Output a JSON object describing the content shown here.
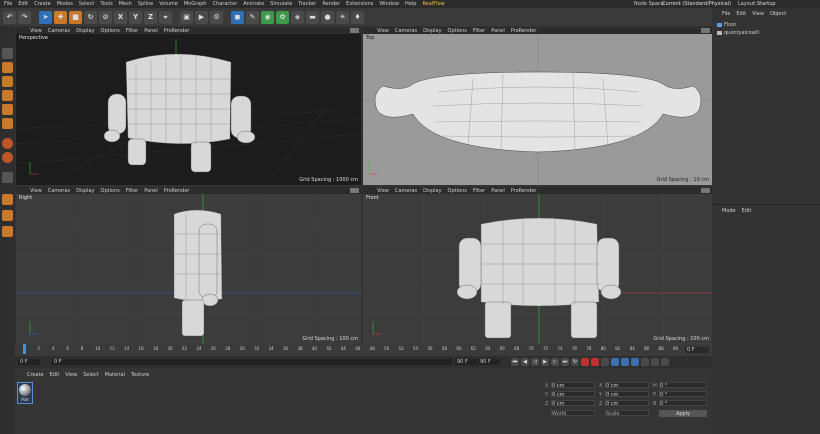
{
  "menu": {
    "items": [
      "File",
      "Edit",
      "Create",
      "Modes",
      "Select",
      "Tools",
      "Mesh",
      "Spline",
      "Volume",
      "MoGraph",
      "Character",
      "Animate",
      "Simulate",
      "Tracker",
      "Render",
      "Extensions",
      "Window",
      "Help",
      "RealFlow"
    ],
    "node_space_label": "Node Space:",
    "node_space_value": "Current (Standard/Physical)",
    "layout_label": "Layout:",
    "layout_value": "Startup"
  },
  "toolbar": {
    "icons": [
      "undo-icon",
      "redo-icon",
      "select-icon",
      "move-icon",
      "scale-icon",
      "rotate-icon",
      "recent-icon",
      "x-axis-icon",
      "y-axis-icon",
      "z-axis-icon",
      "coordinate-system-icon",
      "render-view-icon",
      "render-picture-icon",
      "render-settings-icon",
      "cube-icon",
      "pen-icon",
      "subdivision-icon",
      "cloner-icon",
      "deformer-icon",
      "floor-icon",
      "camera-icon",
      "light-icon",
      "lamp-icon"
    ],
    "axis_labels": [
      "X",
      "Y",
      "Z"
    ]
  },
  "viewport_menu": [
    "View",
    "Cameras",
    "Display",
    "Options",
    "Filter",
    "Panel",
    "ProRender"
  ],
  "viewports": [
    {
      "label": "Perspective",
      "grid": "Grid Spacing : 1000 cm"
    },
    {
      "label": "Top",
      "grid": "Grid Spacing : 10 cm"
    },
    {
      "label": "Right",
      "grid": "Grid Spacing : 100 cm"
    },
    {
      "label": "Front",
      "grid": "Grid Spacing : 100 cm"
    }
  ],
  "object_manager": {
    "menu": [
      "File",
      "Edit",
      "View",
      "Object"
    ],
    "objects": [
      "Floor",
      "quentyalcoaill"
    ]
  },
  "attribute_manager": {
    "menu": [
      "Mode",
      "Edit"
    ]
  },
  "timeline": {
    "ticks": [
      "0",
      "2",
      "4",
      "6",
      "8",
      "10",
      "12",
      "14",
      "16",
      "18",
      "20",
      "22",
      "24",
      "26",
      "28",
      "30",
      "32",
      "34",
      "36",
      "38",
      "40",
      "42",
      "44",
      "46",
      "48",
      "50",
      "52",
      "54",
      "56",
      "58",
      "60",
      "62",
      "64",
      "66",
      "68",
      "70",
      "72",
      "74",
      "76",
      "78",
      "80",
      "82",
      "84",
      "86",
      "88",
      "90"
    ],
    "current_frame": "0 F",
    "start_field": "0 F",
    "start_field2": "0 F",
    "end_field": "90 F",
    "end_field2": "90 F"
  },
  "material_manager": {
    "menu": [
      "Create",
      "Edit",
      "View",
      "Select",
      "Material",
      "Texture"
    ],
    "material_name": "Mat"
  },
  "coordinates": {
    "rows": [
      {
        "a": "X",
        "av": "0 cm",
        "b": "X",
        "bv": "0 cm",
        "c": "H",
        "cv": "0 °"
      },
      {
        "a": "Y",
        "av": "0 cm",
        "b": "Y",
        "bv": "0 cm",
        "c": "P",
        "cv": "0 °"
      },
      {
        "a": "Z",
        "av": "0 cm",
        "b": "Z",
        "bv": "0 cm",
        "c": "B",
        "cv": "0 °"
      }
    ],
    "world": "World",
    "scale": "Scale",
    "apply": "Apply"
  }
}
